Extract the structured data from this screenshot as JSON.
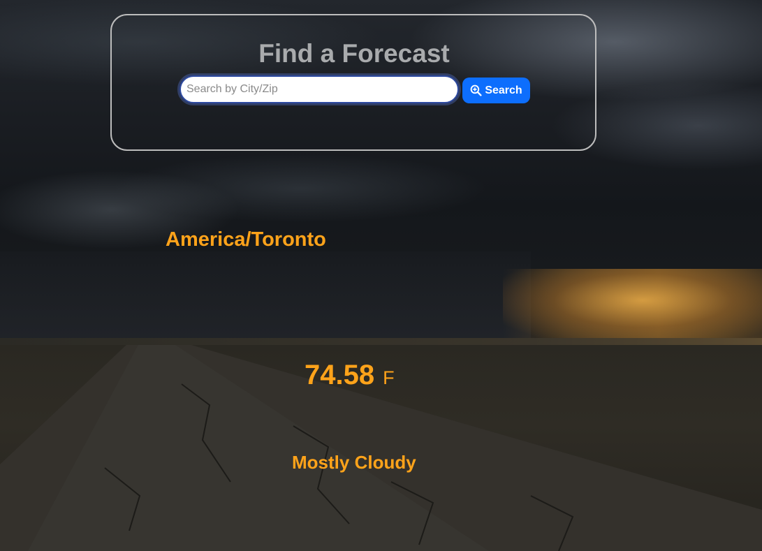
{
  "search_panel": {
    "title": "Find a Forecast",
    "input_placeholder": "Search by City/Zip",
    "input_value": "",
    "button_label": "Search",
    "button_icon": "zoom-in-magnifier-icon"
  },
  "forecast": {
    "timezone": "America/Toronto",
    "temperature": "74.58",
    "unit": "F",
    "condition": "Mostly Cloudy"
  },
  "colors": {
    "accent_orange": "#ffa31a",
    "button_blue": "#0d6efd",
    "title_gray": "#a9abad",
    "panel_border": "#bdbdbd"
  },
  "background": {
    "description_icon": "storm-desert-road-photo"
  }
}
